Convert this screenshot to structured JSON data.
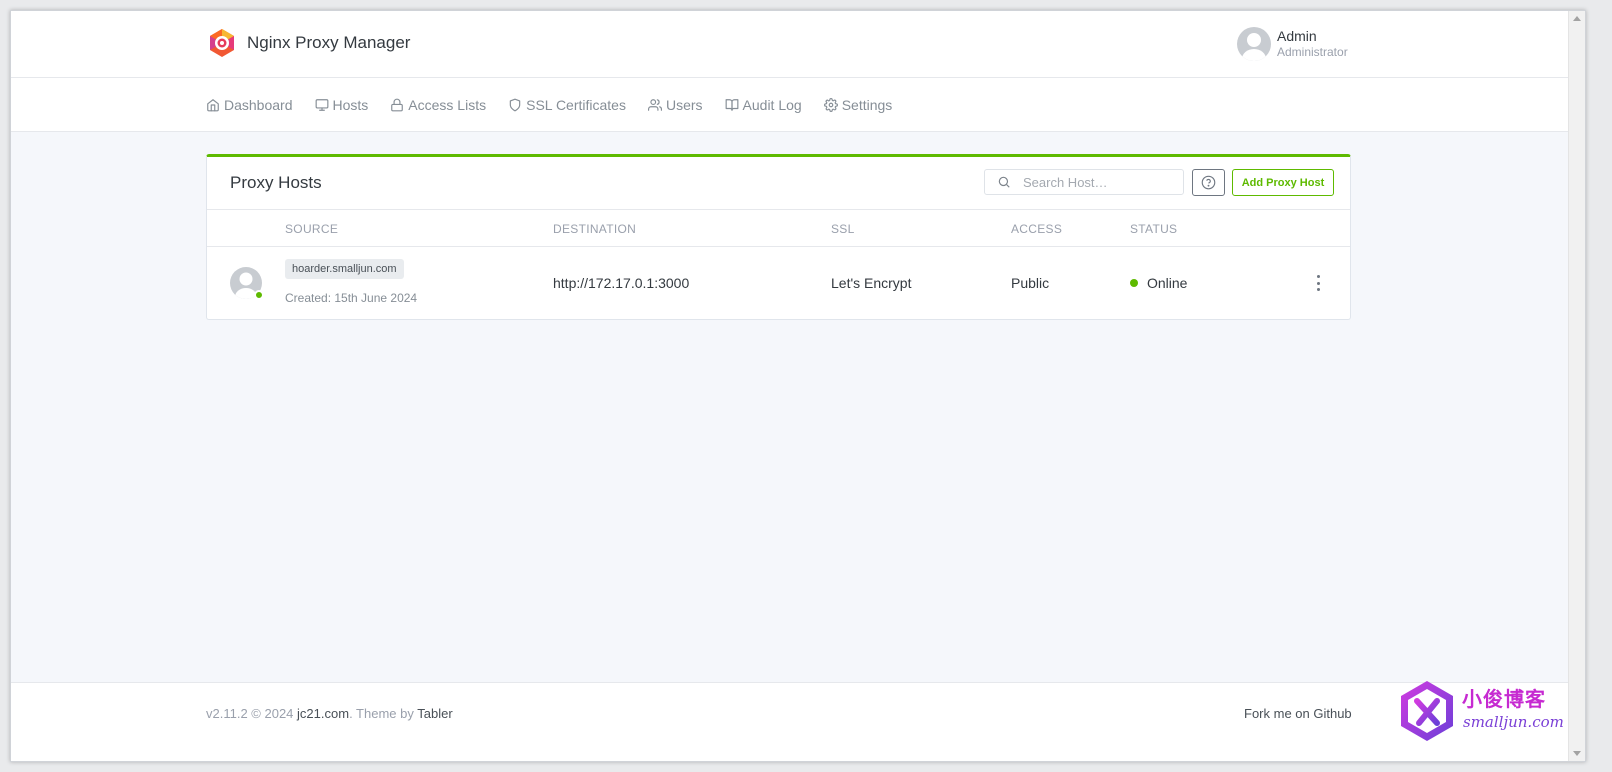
{
  "app": {
    "title": "Nginx Proxy Manager"
  },
  "user": {
    "name": "Admin",
    "role": "Administrator"
  },
  "nav": {
    "items": [
      {
        "label": "Dashboard",
        "icon": "home-icon"
      },
      {
        "label": "Hosts",
        "icon": "monitor-icon"
      },
      {
        "label": "Access Lists",
        "icon": "lock-icon"
      },
      {
        "label": "SSL Certificates",
        "icon": "shield-icon"
      },
      {
        "label": "Users",
        "icon": "users-icon"
      },
      {
        "label": "Audit Log",
        "icon": "book-icon"
      },
      {
        "label": "Settings",
        "icon": "gear-icon"
      }
    ]
  },
  "card": {
    "title": "Proxy Hosts",
    "search_placeholder": "Search Host…",
    "add_label": "Add Proxy Host",
    "accent_color": "#5eba00"
  },
  "table": {
    "headers": {
      "source": "SOURCE",
      "destination": "DESTINATION",
      "ssl": "SSL",
      "access": "ACCESS",
      "status": "STATUS"
    },
    "rows": [
      {
        "domain": "hoarder.smalljun.com",
        "created": "Created: 15th June 2024",
        "destination": "http://172.17.0.1:3000",
        "ssl": "Let's Encrypt",
        "access": "Public",
        "status": "Online"
      }
    ]
  },
  "footer": {
    "version": "v2.11.2 © 2024",
    "author_link": "jc21.com",
    "theme_text": ". Theme by",
    "theme_link": "Tabler",
    "github": "Fork me on Github"
  },
  "watermark": {
    "title": "小俊博客",
    "url": "smalljun.com"
  }
}
